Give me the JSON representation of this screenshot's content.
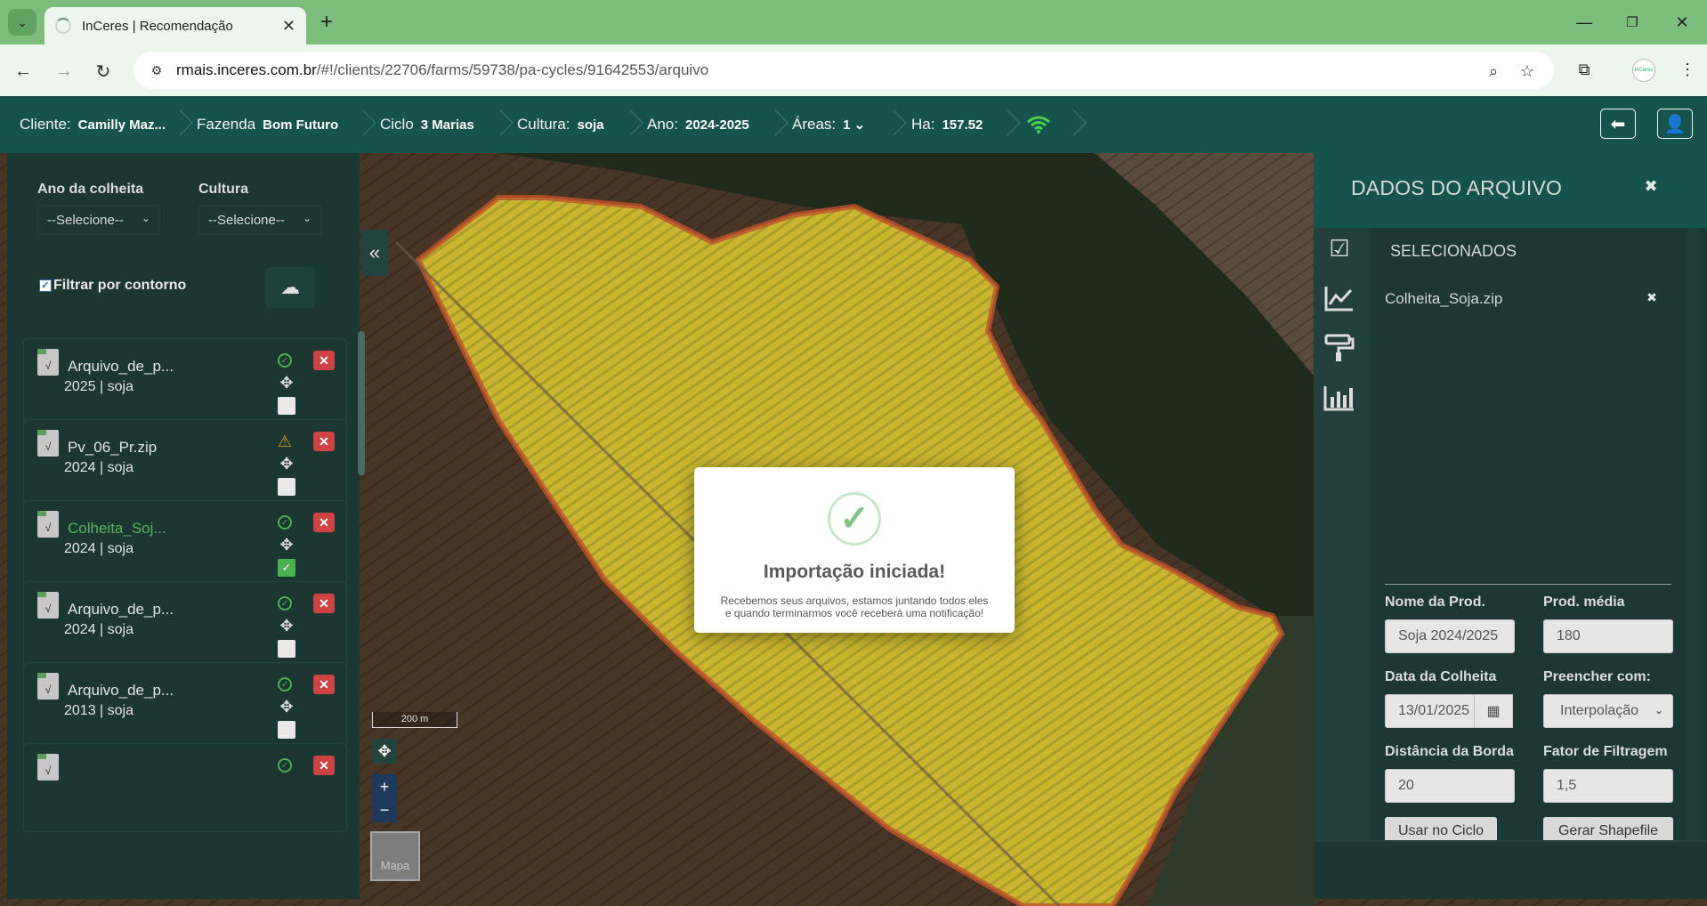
{
  "browser": {
    "tab_title": "InCeres | Recomendação",
    "url_host": "rmais.inceres.com.br",
    "url_path": "/#!/clients/22706/farms/59738/pa-cycles/91642553/arquivo",
    "avatar_text": "InCeres"
  },
  "header": {
    "cliente_label": "Cliente:",
    "cliente_value": "Camilly Maz...",
    "fazenda_label": "Fazenda",
    "fazenda_value": "Bom Futuro",
    "ciclo_label": "Ciclo",
    "ciclo_value": "3 Marias",
    "cultura_label": "Cultura:",
    "cultura_value": "soja",
    "ano_label": "Ano:",
    "ano_value": "2024-2025",
    "areas_label": "Áreas:",
    "areas_value": "1",
    "ha_label": "Ha:",
    "ha_value": "157.52"
  },
  "left_panel": {
    "ano_label": "Ano da colheita",
    "ano_select": "--Selecione--",
    "cultura_label": "Cultura",
    "cultura_select": "--Selecione--",
    "contour_label": "Filtrar por contorno",
    "contour_checked": true,
    "files": [
      {
        "name": "Arquivo_de_p...",
        "meta": "2025 | soja",
        "status": "ok",
        "checked": false,
        "active": false
      },
      {
        "name": "Pv_06_Pr.zip",
        "meta": "2024 | soja",
        "status": "warning",
        "checked": false,
        "active": false
      },
      {
        "name": "Colheita_Soj...",
        "meta": "2024 | soja",
        "status": "ok",
        "checked": true,
        "active": true
      },
      {
        "name": "Arquivo_de_p...",
        "meta": "2024 | soja",
        "status": "ok",
        "checked": false,
        "active": false
      },
      {
        "name": "Arquivo_de_p...",
        "meta": "2013 | soja",
        "status": "ok",
        "checked": false,
        "active": false
      }
    ]
  },
  "map": {
    "scale_label": "200 m",
    "layer_label": "Mapa"
  },
  "right_panel": {
    "title": "DADOS DO ARQUIVO",
    "section_title": "SELECIONADOS",
    "selected_file": "Colheita_Soja.zip",
    "nome_prod_label": "Nome da Prod.",
    "nome_prod_value": "Soja 2024/2025",
    "prod_media_label": "Prod. média",
    "prod_media_value": "180",
    "data_colheita_label": "Data da Colheita",
    "data_colheita_value": "13/01/2025",
    "preencher_label": "Preencher com:",
    "preencher_value": "Interpolação",
    "distancia_label": "Distância da Borda",
    "distancia_value": "20",
    "fator_label": "Fator de Filtragem",
    "fator_value": "1,5",
    "usar_button": "Usar no Ciclo",
    "gerar_button": "Gerar Shapefile"
  },
  "modal": {
    "title": "Importação iniciada!",
    "line1": "Recebemos seus arquivos, estamos juntando todos eles",
    "line2": "e quando terminarmos você receberá uma notificação!"
  }
}
